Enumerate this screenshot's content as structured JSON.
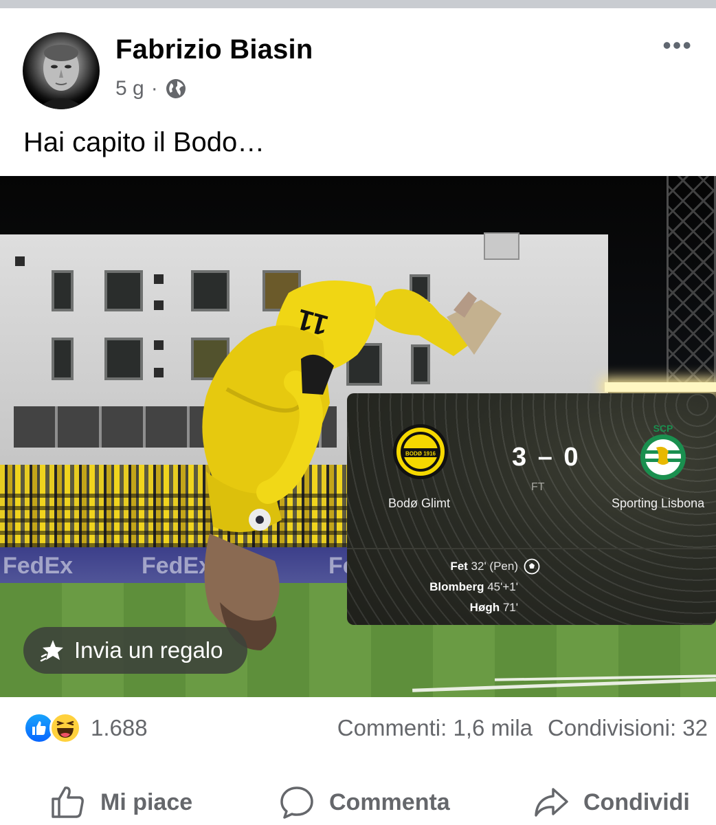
{
  "post": {
    "author": "Fabrizio Biasin",
    "time": "5 g",
    "separator": "·",
    "text": "Hai capito il Bodo…"
  },
  "icons": {
    "audience": "globe-icon",
    "menu": "more-options-icon",
    "gift": "gift-icon",
    "like": "thumbs-up-icon",
    "comment": "comment-bubble-icon",
    "share": "share-arrow-icon"
  },
  "photo": {
    "gift_button": "Invia un regalo",
    "player_number": "11",
    "hoarding_text": "FedEx"
  },
  "match": {
    "home_team": "Bodø Glimt",
    "home_crest_text": "BODØ 1916",
    "away_team": "Sporting Lisbona",
    "away_crest_text": "SCP",
    "score": "3 – 0",
    "status": "FT",
    "scorers": [
      {
        "name": "Fet",
        "minute": "32' (Pen)"
      },
      {
        "name": "Blomberg",
        "minute": "45'+1'"
      },
      {
        "name": "Høgh",
        "minute": "71'"
      }
    ]
  },
  "stats": {
    "reaction_count": "1.688",
    "comments": "Commenti: 1,6 mila",
    "shares": "Condivisioni: 32"
  },
  "actions": {
    "like": "Mi piace",
    "comment": "Commenta",
    "share": "Condividi"
  },
  "colors": {
    "secondary_text": "#65676b",
    "like_blue": "#0866ff",
    "bodo_yellow": "#f5d800",
    "sporting_green": "#1a8f4f"
  }
}
